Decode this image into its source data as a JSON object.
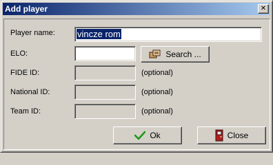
{
  "window": {
    "title": "Add player",
    "close_glyph": "✕"
  },
  "form": {
    "player_name": {
      "label": "Player name:",
      "value": "vincze rom"
    },
    "elo": {
      "label": "ELO:",
      "value": ""
    },
    "fide_id": {
      "label": "FIDE ID:",
      "note": "(optional)"
    },
    "national_id": {
      "label": "National ID:",
      "note": "(optional)"
    },
    "team_id": {
      "label": "Team ID:",
      "note": "(optional)"
    }
  },
  "buttons": {
    "search": {
      "label": "Search ...",
      "icon": "search-icon"
    },
    "ok": {
      "label": "Ok",
      "icon": "checkmark-icon"
    },
    "close": {
      "label": "Close",
      "icon": "door-exit-icon"
    }
  }
}
